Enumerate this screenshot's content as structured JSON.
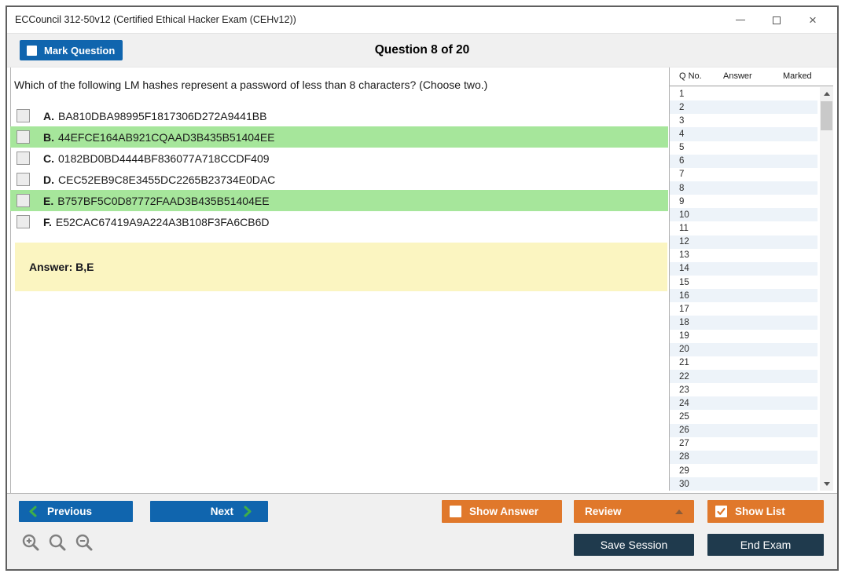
{
  "window": {
    "title": "ECCouncil 312-50v12 (Certified Ethical Hacker Exam (CEHv12))",
    "controls": [
      "minimize",
      "maximize",
      "close"
    ],
    "close_glyph": "×"
  },
  "header": {
    "mark_question_label": "Mark Question",
    "mark_question_checked": false,
    "question_counter": "Question 8 of 20"
  },
  "question": {
    "text": "Which of the following LM hashes represent a password of less than 8 characters? (Choose two.)",
    "options": [
      {
        "letter": "A.",
        "text": "BA810DBA98995F1817306D272A9441BB",
        "highlighted": false,
        "checked": false
      },
      {
        "letter": "B.",
        "text": "44EFCE164AB921CQAAD3B435B51404EE",
        "highlighted": true,
        "checked": false
      },
      {
        "letter": "C.",
        "text": "0182BD0BD4444BF836077A718CCDF409",
        "highlighted": false,
        "checked": false
      },
      {
        "letter": "D.",
        "text": "CEC52EB9C8E3455DC2265B23734E0DAC",
        "highlighted": false,
        "checked": false
      },
      {
        "letter": "E.",
        "text": "B757BF5C0D87772FAAD3B435B51404EE",
        "highlighted": true,
        "checked": false
      },
      {
        "letter": "F.",
        "text": "E52CAC67419A9A224A3B108F3FA6CB6D",
        "highlighted": false,
        "checked": false
      }
    ],
    "answer_label": "Answer: B,E"
  },
  "question_list": {
    "columns": [
      "Q No.",
      "Answer",
      "Marked"
    ],
    "rows": [
      {
        "q_no": "1",
        "answer": "",
        "marked": ""
      },
      {
        "q_no": "2",
        "answer": "",
        "marked": ""
      },
      {
        "q_no": "3",
        "answer": "",
        "marked": ""
      },
      {
        "q_no": "4",
        "answer": "",
        "marked": ""
      },
      {
        "q_no": "5",
        "answer": "",
        "marked": ""
      },
      {
        "q_no": "6",
        "answer": "",
        "marked": ""
      },
      {
        "q_no": "7",
        "answer": "",
        "marked": ""
      },
      {
        "q_no": "8",
        "answer": "",
        "marked": ""
      },
      {
        "q_no": "9",
        "answer": "",
        "marked": ""
      },
      {
        "q_no": "10",
        "answer": "",
        "marked": ""
      },
      {
        "q_no": "11",
        "answer": "",
        "marked": ""
      },
      {
        "q_no": "12",
        "answer": "",
        "marked": ""
      },
      {
        "q_no": "13",
        "answer": "",
        "marked": ""
      },
      {
        "q_no": "14",
        "answer": "",
        "marked": ""
      },
      {
        "q_no": "15",
        "answer": "",
        "marked": ""
      },
      {
        "q_no": "16",
        "answer": "",
        "marked": ""
      },
      {
        "q_no": "17",
        "answer": "",
        "marked": ""
      },
      {
        "q_no": "18",
        "answer": "",
        "marked": ""
      },
      {
        "q_no": "19",
        "answer": "",
        "marked": ""
      },
      {
        "q_no": "20",
        "answer": "",
        "marked": ""
      },
      {
        "q_no": "21",
        "answer": "",
        "marked": ""
      },
      {
        "q_no": "22",
        "answer": "",
        "marked": ""
      },
      {
        "q_no": "23",
        "answer": "",
        "marked": ""
      },
      {
        "q_no": "24",
        "answer": "",
        "marked": ""
      },
      {
        "q_no": "25",
        "answer": "",
        "marked": ""
      },
      {
        "q_no": "26",
        "answer": "",
        "marked": ""
      },
      {
        "q_no": "27",
        "answer": "",
        "marked": ""
      },
      {
        "q_no": "28",
        "answer": "",
        "marked": ""
      },
      {
        "q_no": "29",
        "answer": "",
        "marked": ""
      },
      {
        "q_no": "30",
        "answer": "",
        "marked": ""
      }
    ]
  },
  "footer": {
    "previous_label": "Previous",
    "next_label": "Next",
    "show_answer_label": "Show Answer",
    "show_answer_checked": false,
    "review_label": "Review",
    "show_list_label": "Show List",
    "show_list_checked": true,
    "save_session_label": "Save Session",
    "end_exam_label": "End Exam"
  },
  "icons": {
    "window": [
      "minimize-icon",
      "maximize-icon",
      "close-icon"
    ],
    "previous_button": "chevron-left-icon",
    "next_button": "chevron-right-icon",
    "review_button": "caret-up-icon",
    "zoom_toolbar": [
      "zoom-in-icon",
      "zoom-reset-icon",
      "zoom-out-icon"
    ],
    "scrollbar": [
      "scroll-up-icon",
      "scroll-down-icon"
    ]
  },
  "colors": {
    "primary_blue": "#1065ae",
    "accent_orange": "#e0782b",
    "dark_navy": "#1f3a4d",
    "chevron_green": "#3fae49",
    "highlight_green": "#a6e69b",
    "answer_yellow": "#fbf5c1",
    "alt_row_blue": "#edf3f9"
  }
}
